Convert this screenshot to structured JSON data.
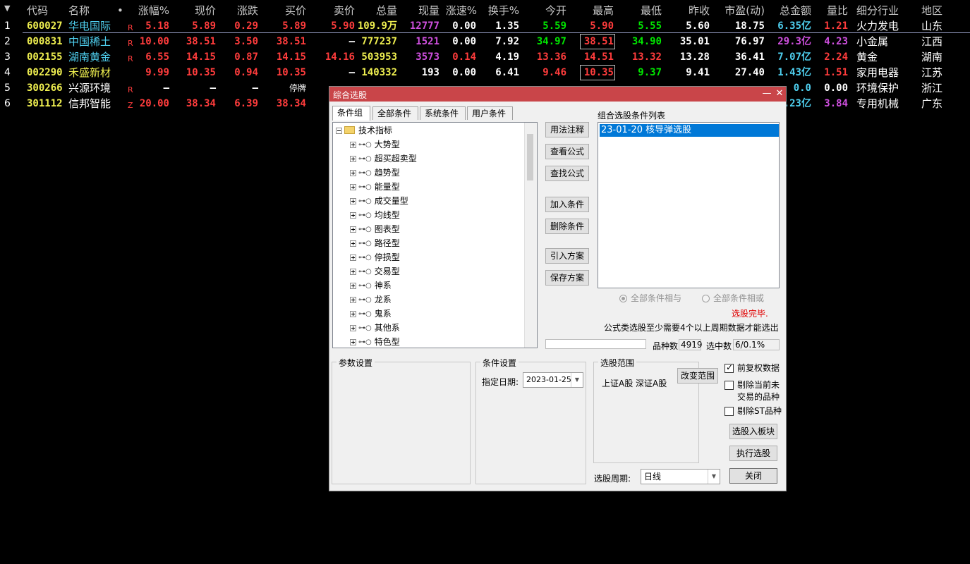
{
  "table": {
    "sort_arrow": "sort-down-icon",
    "headers": [
      "代码",
      "名称",
      "•",
      "涨幅%",
      "现价",
      "涨跌",
      "买价",
      "卖价",
      "总量",
      "现量",
      "涨速%",
      "换手%",
      "今开",
      "最高",
      "最低",
      "昨收",
      "市盈(动)",
      "总金额",
      "量比",
      "细分行业",
      "地区"
    ],
    "rows": [
      {
        "idx": "1",
        "code": "600027",
        "name": "华电国际",
        "flag": "R",
        "chg_pct": "5.18",
        "price": "5.89",
        "chg": "0.29",
        "bid": "5.89",
        "ask": "5.90",
        "vol": "109.9万",
        "cur_vol": "12777",
        "speed": "0.00",
        "turnover": "1.35",
        "open": "5.59",
        "high": "5.90",
        "low": "5.55",
        "prev": "5.60",
        "pe": "18.75",
        "amount": "6.35亿",
        "vol_ratio": "1.21",
        "industry": "火力发电",
        "region": "山东"
      },
      {
        "idx": "2",
        "code": "000831",
        "name": "中国稀土",
        "flag": "R",
        "chg_pct": "10.00",
        "price": "38.51",
        "chg": "3.50",
        "bid": "38.51",
        "ask": "—",
        "vol": "777237",
        "cur_vol": "1521",
        "speed": "0.00",
        "turnover": "7.92",
        "open": "34.97",
        "high": "38.51",
        "low": "34.90",
        "prev": "35.01",
        "pe": "76.97",
        "amount": "29.3亿",
        "vol_ratio": "4.23",
        "industry": "小金属",
        "region": "江西"
      },
      {
        "idx": "3",
        "code": "002155",
        "name": "湖南黄金",
        "flag": "R",
        "chg_pct": "6.55",
        "price": "14.15",
        "chg": "0.87",
        "bid": "14.15",
        "ask": "14.16",
        "vol": "503953",
        "cur_vol": "3573",
        "speed": "0.14",
        "turnover": "4.19",
        "open": "13.36",
        "high": "14.51",
        "low": "13.32",
        "prev": "13.28",
        "pe": "36.41",
        "amount": "7.07亿",
        "vol_ratio": "2.24",
        "industry": "黄金",
        "region": "湖南"
      },
      {
        "idx": "4",
        "code": "002290",
        "name": "禾盛新材",
        "flag": "",
        "chg_pct": "9.99",
        "price": "10.35",
        "chg": "0.94",
        "bid": "10.35",
        "ask": "—",
        "vol": "140332",
        "cur_vol": "193",
        "speed": "0.00",
        "turnover": "6.41",
        "open": "9.46",
        "high": "10.35",
        "low": "9.37",
        "prev": "9.41",
        "pe": "27.40",
        "amount": "1.43亿",
        "vol_ratio": "1.51",
        "industry": "家用电器",
        "region": "江苏"
      },
      {
        "idx": "5",
        "code": "300266",
        "name": "兴源环境",
        "flag": "R",
        "chg_pct": "—",
        "price": "—",
        "chg": "—",
        "bid": "停牌",
        "ask": "",
        "vol": "",
        "cur_vol": "",
        "speed": "",
        "turnover": "",
        "open": "",
        "high": "",
        "low": "",
        "prev": "",
        "pe": "",
        "amount": "0.0",
        "vol_ratio": "0.00",
        "industry": "环境保护",
        "region": "浙江"
      },
      {
        "idx": "6",
        "code": "301112",
        "name": "信邦智能",
        "flag": "Z",
        "chg_pct": "20.00",
        "price": "38.34",
        "chg": "6.39",
        "bid": "38.34",
        "ask": "",
        "vol": "",
        "cur_vol": "",
        "speed": "",
        "turnover": "",
        "open": "",
        "high": "",
        "low": "",
        "prev": "",
        "pe": "",
        "amount": ".23亿",
        "vol_ratio": "3.84",
        "industry": "专用机械",
        "region": "广东"
      }
    ]
  },
  "dialog": {
    "title": "综合选股",
    "minimize": "—",
    "close": "✕",
    "tabs": [
      "条件组",
      "全部条件",
      "系统条件",
      "用户条件"
    ],
    "tree_root": "技术指标",
    "tree_items": [
      "大势型",
      "超买超卖型",
      "趋势型",
      "能量型",
      "成交量型",
      "均线型",
      "图表型",
      "路径型",
      "停损型",
      "交易型",
      "神系",
      "龙系",
      "鬼系",
      "其他系",
      "特色型"
    ],
    "buttons": {
      "usage": "用法注释",
      "view_formula": "查看公式",
      "find_formula": "查找公式",
      "add_condition": "加入条件",
      "delete_condition": "删除条件",
      "import_plan": "引入方案",
      "save_plan": "保存方案",
      "change_range": "改变范围",
      "to_block": "选股入板块",
      "execute": "执行选股",
      "close": "关闭"
    },
    "list_title": "组合选股条件列表",
    "list_items": [
      "23-01-20 核导弹选股"
    ],
    "radio_and": "全部条件相与",
    "radio_or": "全部条件相或",
    "status_done": "选股完毕.",
    "note": "公式类选股至少需要4个以上周期数据才能选出",
    "count_label": "品种数",
    "count_value": "4919",
    "selected_label": "选中数",
    "selected_value": "6/0.1%",
    "param_title": "参数设置",
    "cond_title": "条件设置",
    "date_label": "指定日期:",
    "date_value": "2023-01-25",
    "range_title": "选股范围",
    "range_value": "上证A股 深证A股",
    "chk_adjust": "前复权数据",
    "chk_exclude_suspended_1": "剔除当前未",
    "chk_exclude_suspended_2": "交易的品种",
    "chk_exclude_st": "剔除ST品种",
    "period_label": "选股周期:",
    "period_value": "日线",
    "colors": {
      "title_bar": "#c94549",
      "selected": "#0078d7",
      "status_done": "#e00000"
    }
  },
  "colors": {
    "up": "#ff3c3c",
    "down": "#00e600",
    "code": "#f0f050",
    "name_cyan": "#4fd0f0",
    "purple": "#d050e0",
    "yellow": "#f0f050",
    "white": "#ffffff"
  }
}
